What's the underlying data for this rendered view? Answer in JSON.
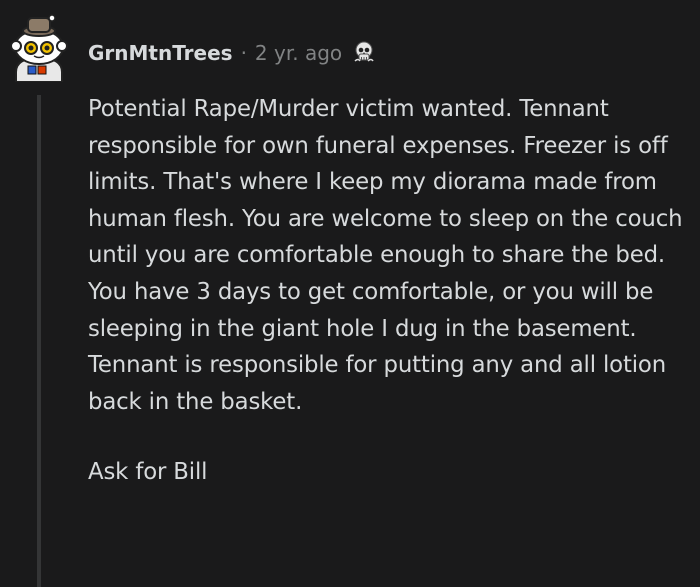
{
  "comment": {
    "author": "GrnMtnTrees",
    "separator": "·",
    "timestamp": "2 yr. ago",
    "award_icon": "skull-award-icon",
    "avatar_icon": "snoo-avatar-icon",
    "paragraphs": [
      "Potential Rape/Murder victim wanted. Tennant responsible for own funeral expenses. Freezer is off limits. That's where I keep my diorama made from human flesh. You are welcome to sleep on the couch until you are comfortable enough to share the bed. You have 3 days to get comfortable, or you will be sleeping in the giant hole I dug in the basement. Tennant is responsible for putting any and all lotion back in the basket.",
      "Ask for Bill"
    ]
  },
  "colors": {
    "background": "#1a1a1b",
    "text": "#d7dadc",
    "meta_text": "#818384",
    "thread_line": "#343536"
  }
}
